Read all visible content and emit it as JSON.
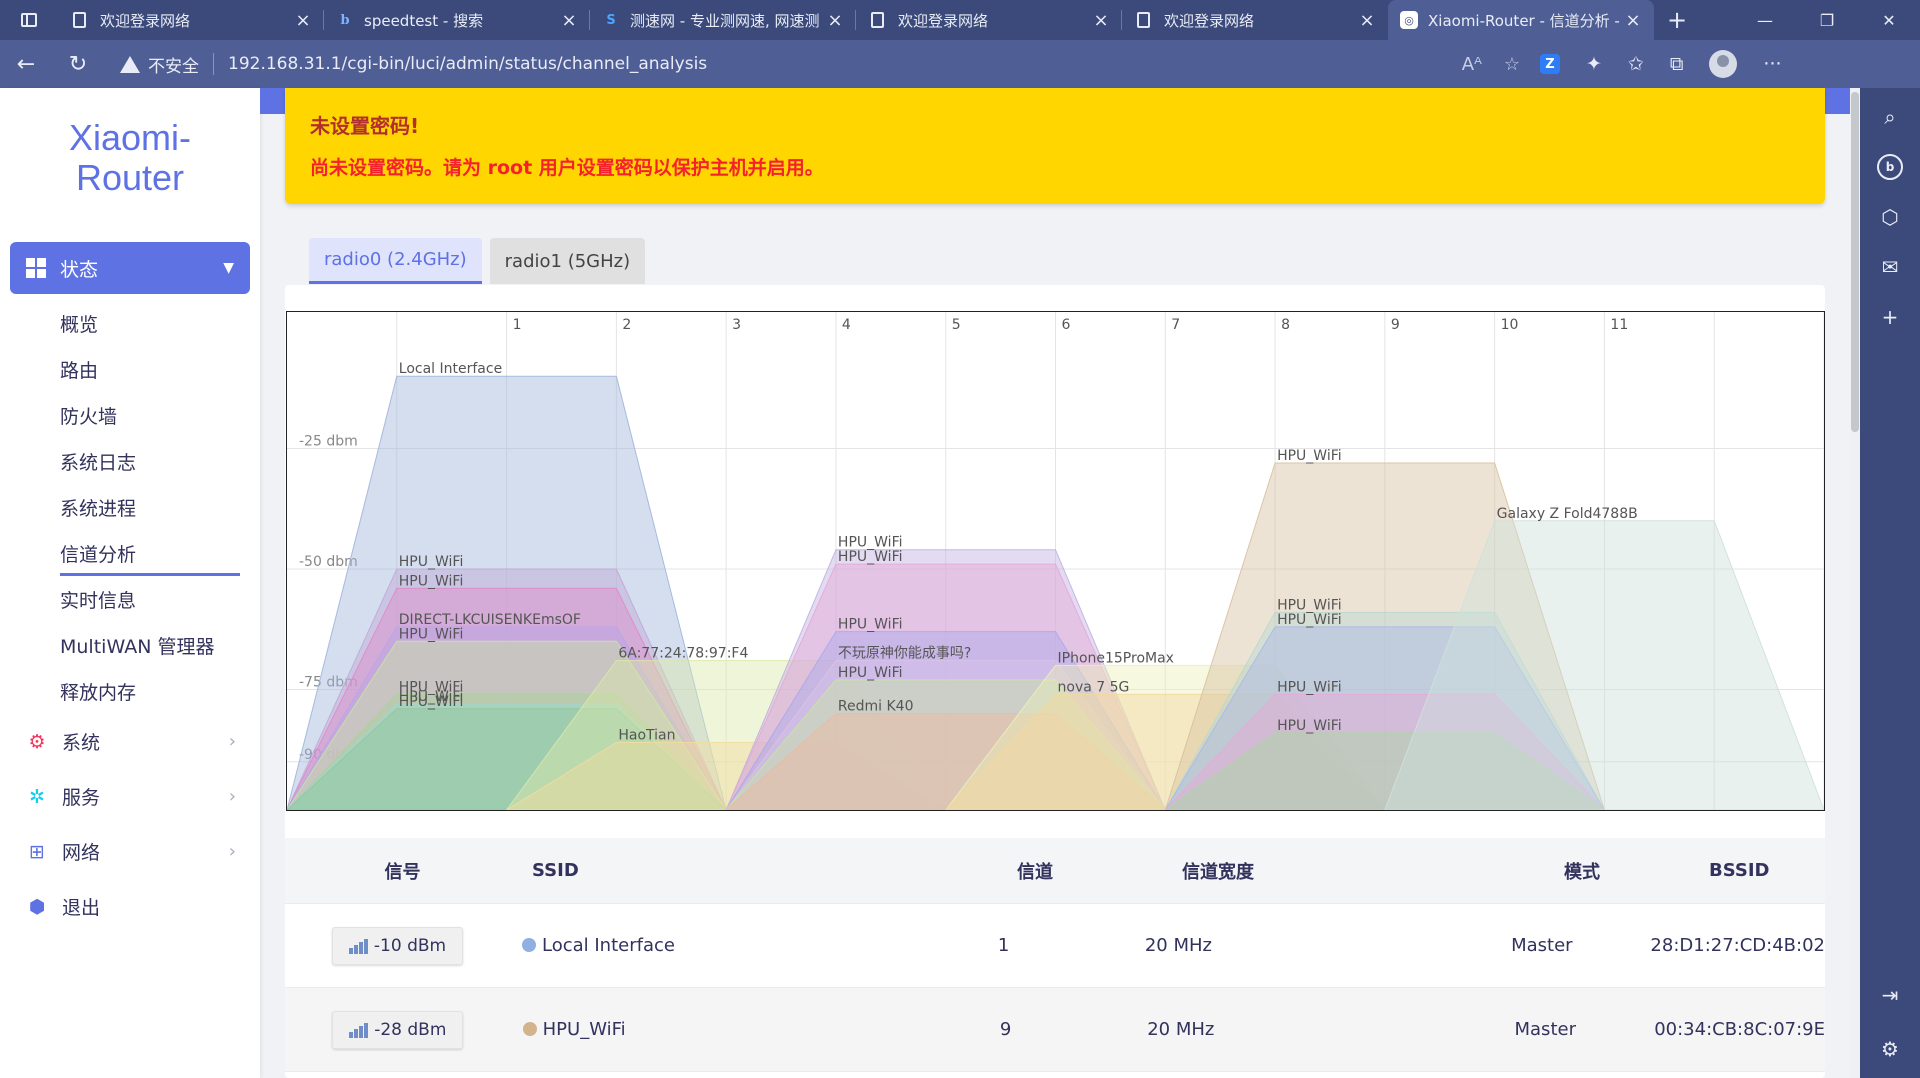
{
  "browser": {
    "tabs": [
      {
        "title": "欢迎登录网络",
        "icon": "page-icon",
        "active": false
      },
      {
        "title": "speedtest - 搜索",
        "icon": "bing-icon",
        "active": false
      },
      {
        "title": "测速网 - 专业测网速, 网速测",
        "icon": "speedtest-icon",
        "active": false
      },
      {
        "title": "欢迎登录网络",
        "icon": "page-icon",
        "active": false
      },
      {
        "title": "欢迎登录网络",
        "icon": "page-icon",
        "active": false
      },
      {
        "title": "Xiaomi-Router - 信道分析 -",
        "icon": "router-icon",
        "active": true
      }
    ],
    "security_label": "不安全",
    "url": "192.168.31.1/cgi-bin/luci/admin/status/channel_analysis"
  },
  "sidebar": {
    "brand_line1": "Xiaomi-",
    "brand_line2": "Router",
    "active_menu": "状态",
    "sub_items": [
      "概览",
      "路由",
      "防火墙",
      "系统日志",
      "系统进程",
      "信道分析",
      "实时信息",
      "MultiWAN 管理器",
      "释放内存"
    ],
    "active_sub": "信道分析",
    "menus": [
      {
        "label": "系统",
        "icon": "gear-icon",
        "color": "#f5365c"
      },
      {
        "label": "服务",
        "icon": "services-icon",
        "color": "#11cdef"
      },
      {
        "label": "网络",
        "icon": "network-icon",
        "color": "#5e72e4"
      },
      {
        "label": "退出",
        "icon": "logout-icon",
        "color": "#5e72e4"
      }
    ]
  },
  "alert": {
    "title": "未设置密码!",
    "message": "尚未设置密码。请为 root 用户设置密码以保护主机并启用。"
  },
  "radio_tabs": [
    {
      "label": "radio0 (2.4GHz)",
      "active": true
    },
    {
      "label": "radio1 (5GHz)",
      "active": false
    }
  ],
  "chart_data": {
    "type": "area",
    "x_ticks": [
      "1",
      "2",
      "3",
      "4",
      "5",
      "6",
      "7",
      "8",
      "9",
      "10",
      "11"
    ],
    "y_ticks": [
      "-25 dbm",
      "-50 dbm",
      "-75 dbm",
      "-90 dbm"
    ],
    "y_tick_values": [
      -25,
      -50,
      -75,
      -90
    ],
    "xlim": [
      -1,
      13
    ],
    "ylim": [
      -100,
      0
    ],
    "grid": true,
    "series": [
      {
        "name": "Local Interface",
        "channel": 1,
        "signal": -10,
        "color": "#9fb5dc"
      },
      {
        "name": "HPU_WiFi",
        "channel": 1,
        "signal": -50,
        "color": "#c0a7d8"
      },
      {
        "name": "HPU_WiFi",
        "channel": 1,
        "signal": -54,
        "color": "#e08ac8"
      },
      {
        "name": "DIRECT-LKCUISENKEmsOF",
        "channel": 1,
        "signal": -62,
        "color": "#b8a6e6"
      },
      {
        "name": "HPU_WiFi",
        "channel": 1,
        "signal": -65,
        "color": "#c8e6a0"
      },
      {
        "name": "HPU_WiFi",
        "channel": 1,
        "signal": -76,
        "color": "#a9d39a"
      },
      {
        "name": "HPU_WiFi",
        "channel": 1,
        "signal": -78,
        "color": "#9fd7cc"
      },
      {
        "name": "HPU_WiFi",
        "channel": 1,
        "signal": -79,
        "color": "#8cc8a0"
      },
      {
        "name": "6A:77:24:78:97:F4",
        "channel": 3,
        "signal": -69,
        "color": "#dce8a8"
      },
      {
        "name": "HaoTian",
        "channel": 3,
        "signal": -86,
        "color": "#f2dca0"
      },
      {
        "name": "HPU_WiFi",
        "channel": 5,
        "signal": -46,
        "color": "#c0b0e0"
      },
      {
        "name": "HPU_WiFi",
        "channel": 5,
        "signal": -49,
        "color": "#e4a8d8"
      },
      {
        "name": "HPU_WiFi",
        "channel": 5,
        "signal": -63,
        "color": "#a8a8ec"
      },
      {
        "name": "不玩原神你能成事吗?",
        "channel": 5,
        "signal": -69,
        "color": "#d8c4e8"
      },
      {
        "name": "HPU_WiFi",
        "channel": 5,
        "signal": -73,
        "color": "#c8e6a0"
      },
      {
        "name": "Redmi K40",
        "channel": 5,
        "signal": -80,
        "color": "#f0b8a0"
      },
      {
        "name": "IPhone15ProMax",
        "channel": 7,
        "signal": -70,
        "color": "#ecf0b8"
      },
      {
        "name": "nova 7 5G",
        "channel": 7,
        "signal": -76,
        "color": "#f2d8a0"
      },
      {
        "name": "HPU_WiFi",
        "channel": 9,
        "signal": -28,
        "color": "#d8c0a0"
      },
      {
        "name": "HPU_WiFi",
        "channel": 9,
        "signal": -59,
        "color": "#b8d8d0"
      },
      {
        "name": "HPU_WiFi",
        "channel": 9,
        "signal": -62,
        "color": "#a8b8ec"
      },
      {
        "name": "HPU_WiFi",
        "channel": 9,
        "signal": -76,
        "color": "#e8a8d8"
      },
      {
        "name": "HPU_WiFi",
        "channel": 9,
        "signal": -84,
        "color": "#a8d8a0"
      },
      {
        "name": "Galaxy Z Fold4788B",
        "channel": 11,
        "signal": -40,
        "color": "#cfe0dc"
      }
    ]
  },
  "table": {
    "headers": [
      "信号",
      "SSID",
      "信道",
      "信道宽度",
      "模式",
      "BSSID"
    ],
    "rows": [
      {
        "signal": "-10 dBm",
        "ssid": "Local Interface",
        "dot_color": "#8fb0e0",
        "channel": "1",
        "width": "20 MHz",
        "mode": "Master",
        "bssid": "28:D1:27:CD:4B:02"
      },
      {
        "signal": "-28 dBm",
        "ssid": "HPU_WiFi",
        "dot_color": "#d2b48c",
        "channel": "9",
        "width": "20 MHz",
        "mode": "Master",
        "bssid": "00:34:CB:8C:07:9E"
      }
    ]
  }
}
